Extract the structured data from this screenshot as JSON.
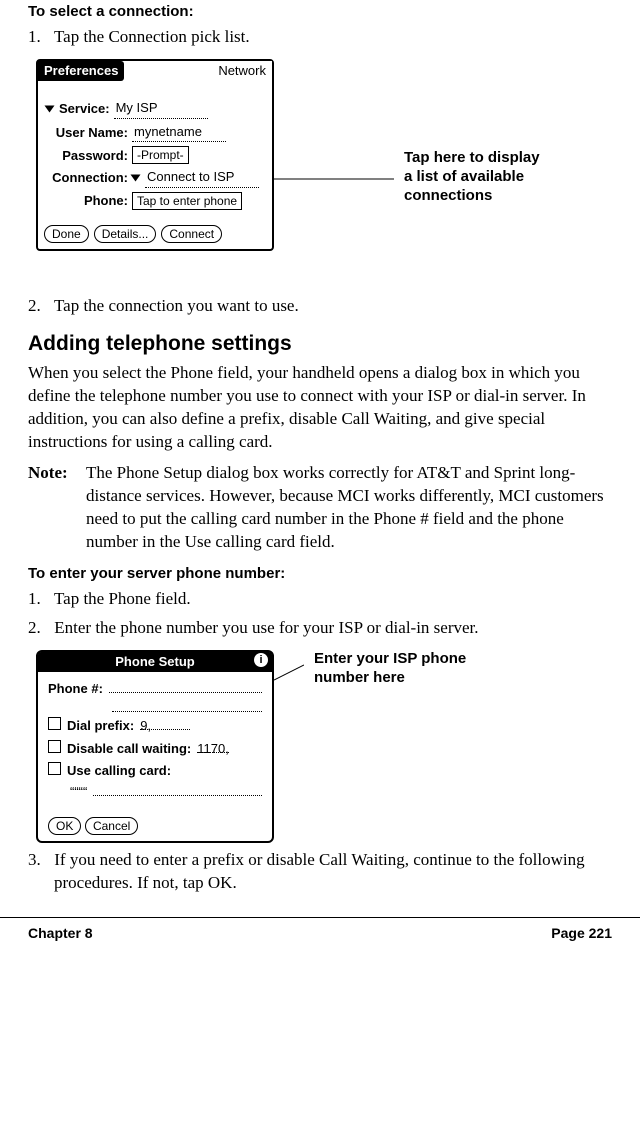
{
  "heading1": "To select a connection:",
  "steps1": {
    "s1_num": "1.",
    "s1_text": "Tap the Connection pick list.",
    "s2_num": "2.",
    "s2_text": "Tap the connection you want to use."
  },
  "prefs_win": {
    "title_left": "Preferences",
    "title_right": "Network",
    "rows": {
      "service_label": "Service:",
      "service_value": "My ISP",
      "user_label": "User Name:",
      "user_value": "mynetname",
      "password_label": "Password:",
      "password_value": "-Prompt-",
      "connection_label": "Connection:",
      "connection_value": "Connect to ISP",
      "phone_label": "Phone:",
      "phone_value": "Tap to enter phone"
    },
    "buttons": {
      "done": "Done",
      "details": "Details...",
      "connect": "Connect"
    }
  },
  "callout1": {
    "l1": "Tap here to display",
    "l2": "a list of available",
    "l3": "connections"
  },
  "h2": "Adding telephone settings",
  "para1": "When you select the Phone field, your handheld opens a dialog box in which you define the telephone number you use to connect with your ISP or dial-in server. In addition, you can also define a prefix, disable Call Waiting, and give special instructions for using a calling card.",
  "note": {
    "label": "Note:",
    "text": "The Phone Setup dialog box works correctly for AT&T and Sprint long-distance services. However, because MCI works differently, MCI customers need to put the calling card number in the Phone # field and the phone number in the Use calling card field."
  },
  "heading2": "To enter your server phone number:",
  "steps2": {
    "s1_num": "1.",
    "s1_text": "Tap the Phone field.",
    "s2_num": "2.",
    "s2_text": "Enter the phone number you use for your ISP or dial-in server.",
    "s3_num": "3.",
    "s3_text": "If you need to enter a prefix or disable Call Waiting, continue to the following procedures. If not, tap OK."
  },
  "phone_win": {
    "title": "Phone Setup",
    "phone_num_label": "Phone #:",
    "dial_prefix_label": "Dial prefix:",
    "dial_prefix_value": "9,",
    "disable_cw_label": "Disable call waiting:",
    "disable_cw_value": "1170,",
    "use_cc_label": "Use calling card:",
    "use_cc_value": "““““",
    "ok": "OK",
    "cancel": "Cancel"
  },
  "callout2": {
    "l1": "Enter your ISP phone",
    "l2": "number here"
  },
  "footer": {
    "left": "Chapter 8",
    "right": "Page 221"
  }
}
